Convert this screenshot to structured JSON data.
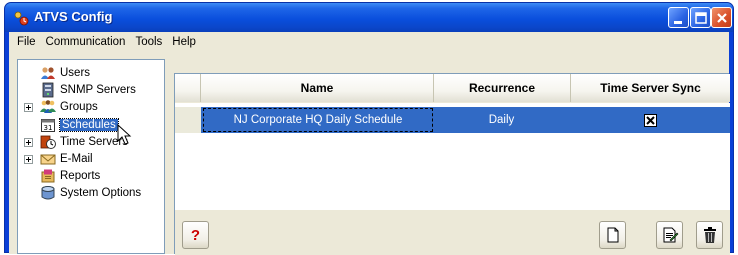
{
  "window": {
    "title": "ATVS Config",
    "app_icon": "atvs-app-icon"
  },
  "menu": [
    "File",
    "Communication",
    "Tools",
    "Help"
  ],
  "tree": {
    "items": [
      {
        "label": "Users",
        "icon": "users-icon",
        "expandable": false
      },
      {
        "label": "SNMP Servers",
        "icon": "server-icon",
        "expandable": false
      },
      {
        "label": "Groups",
        "icon": "groups-icon",
        "expandable": true
      },
      {
        "label": "Schedules",
        "icon": "calendar-icon",
        "expandable": false,
        "selected": true
      },
      {
        "label": "Time Servers",
        "icon": "time-server-icon",
        "expandable": true
      },
      {
        "label": "E-Mail",
        "icon": "email-icon",
        "expandable": true
      },
      {
        "label": "Reports",
        "icon": "reports-icon",
        "expandable": false
      },
      {
        "label": "System Options",
        "icon": "system-options-icon",
        "expandable": false
      }
    ]
  },
  "grid": {
    "columns": [
      "Name",
      "Recurrence",
      "Time Server Sync"
    ],
    "rows": [
      {
        "name": "NJ Corporate HQ Daily Schedule",
        "recurrence": "Daily",
        "time_server_sync": true
      }
    ]
  },
  "toolbar": {
    "help_icon": "help-icon",
    "new_icon": "new-document-icon",
    "edit_icon": "edit-icon",
    "delete_icon": "trash-icon"
  },
  "colors": {
    "titlebar": "#0a4fdd",
    "selection": "#316ac5",
    "window_bg": "#ece9d8"
  }
}
